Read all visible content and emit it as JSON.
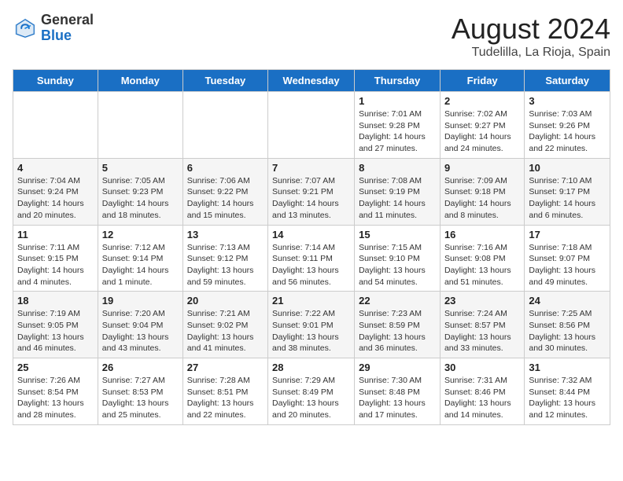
{
  "header": {
    "logo_general": "General",
    "logo_blue": "Blue",
    "month": "August 2024",
    "location": "Tudelilla, La Rioja, Spain"
  },
  "days_of_week": [
    "Sunday",
    "Monday",
    "Tuesday",
    "Wednesday",
    "Thursday",
    "Friday",
    "Saturday"
  ],
  "weeks": [
    [
      {
        "day": "",
        "info": ""
      },
      {
        "day": "",
        "info": ""
      },
      {
        "day": "",
        "info": ""
      },
      {
        "day": "",
        "info": ""
      },
      {
        "day": "1",
        "info": "Sunrise: 7:01 AM\nSunset: 9:28 PM\nDaylight: 14 hours and 27 minutes."
      },
      {
        "day": "2",
        "info": "Sunrise: 7:02 AM\nSunset: 9:27 PM\nDaylight: 14 hours and 24 minutes."
      },
      {
        "day": "3",
        "info": "Sunrise: 7:03 AM\nSunset: 9:26 PM\nDaylight: 14 hours and 22 minutes."
      }
    ],
    [
      {
        "day": "4",
        "info": "Sunrise: 7:04 AM\nSunset: 9:24 PM\nDaylight: 14 hours and 20 minutes."
      },
      {
        "day": "5",
        "info": "Sunrise: 7:05 AM\nSunset: 9:23 PM\nDaylight: 14 hours and 18 minutes."
      },
      {
        "day": "6",
        "info": "Sunrise: 7:06 AM\nSunset: 9:22 PM\nDaylight: 14 hours and 15 minutes."
      },
      {
        "day": "7",
        "info": "Sunrise: 7:07 AM\nSunset: 9:21 PM\nDaylight: 14 hours and 13 minutes."
      },
      {
        "day": "8",
        "info": "Sunrise: 7:08 AM\nSunset: 9:19 PM\nDaylight: 14 hours and 11 minutes."
      },
      {
        "day": "9",
        "info": "Sunrise: 7:09 AM\nSunset: 9:18 PM\nDaylight: 14 hours and 8 minutes."
      },
      {
        "day": "10",
        "info": "Sunrise: 7:10 AM\nSunset: 9:17 PM\nDaylight: 14 hours and 6 minutes."
      }
    ],
    [
      {
        "day": "11",
        "info": "Sunrise: 7:11 AM\nSunset: 9:15 PM\nDaylight: 14 hours and 4 minutes."
      },
      {
        "day": "12",
        "info": "Sunrise: 7:12 AM\nSunset: 9:14 PM\nDaylight: 14 hours and 1 minute."
      },
      {
        "day": "13",
        "info": "Sunrise: 7:13 AM\nSunset: 9:12 PM\nDaylight: 13 hours and 59 minutes."
      },
      {
        "day": "14",
        "info": "Sunrise: 7:14 AM\nSunset: 9:11 PM\nDaylight: 13 hours and 56 minutes."
      },
      {
        "day": "15",
        "info": "Sunrise: 7:15 AM\nSunset: 9:10 PM\nDaylight: 13 hours and 54 minutes."
      },
      {
        "day": "16",
        "info": "Sunrise: 7:16 AM\nSunset: 9:08 PM\nDaylight: 13 hours and 51 minutes."
      },
      {
        "day": "17",
        "info": "Sunrise: 7:18 AM\nSunset: 9:07 PM\nDaylight: 13 hours and 49 minutes."
      }
    ],
    [
      {
        "day": "18",
        "info": "Sunrise: 7:19 AM\nSunset: 9:05 PM\nDaylight: 13 hours and 46 minutes."
      },
      {
        "day": "19",
        "info": "Sunrise: 7:20 AM\nSunset: 9:04 PM\nDaylight: 13 hours and 43 minutes."
      },
      {
        "day": "20",
        "info": "Sunrise: 7:21 AM\nSunset: 9:02 PM\nDaylight: 13 hours and 41 minutes."
      },
      {
        "day": "21",
        "info": "Sunrise: 7:22 AM\nSunset: 9:01 PM\nDaylight: 13 hours and 38 minutes."
      },
      {
        "day": "22",
        "info": "Sunrise: 7:23 AM\nSunset: 8:59 PM\nDaylight: 13 hours and 36 minutes."
      },
      {
        "day": "23",
        "info": "Sunrise: 7:24 AM\nSunset: 8:57 PM\nDaylight: 13 hours and 33 minutes."
      },
      {
        "day": "24",
        "info": "Sunrise: 7:25 AM\nSunset: 8:56 PM\nDaylight: 13 hours and 30 minutes."
      }
    ],
    [
      {
        "day": "25",
        "info": "Sunrise: 7:26 AM\nSunset: 8:54 PM\nDaylight: 13 hours and 28 minutes."
      },
      {
        "day": "26",
        "info": "Sunrise: 7:27 AM\nSunset: 8:53 PM\nDaylight: 13 hours and 25 minutes."
      },
      {
        "day": "27",
        "info": "Sunrise: 7:28 AM\nSunset: 8:51 PM\nDaylight: 13 hours and 22 minutes."
      },
      {
        "day": "28",
        "info": "Sunrise: 7:29 AM\nSunset: 8:49 PM\nDaylight: 13 hours and 20 minutes."
      },
      {
        "day": "29",
        "info": "Sunrise: 7:30 AM\nSunset: 8:48 PM\nDaylight: 13 hours and 17 minutes."
      },
      {
        "day": "30",
        "info": "Sunrise: 7:31 AM\nSunset: 8:46 PM\nDaylight: 13 hours and 14 minutes."
      },
      {
        "day": "31",
        "info": "Sunrise: 7:32 AM\nSunset: 8:44 PM\nDaylight: 13 hours and 12 minutes."
      }
    ]
  ]
}
